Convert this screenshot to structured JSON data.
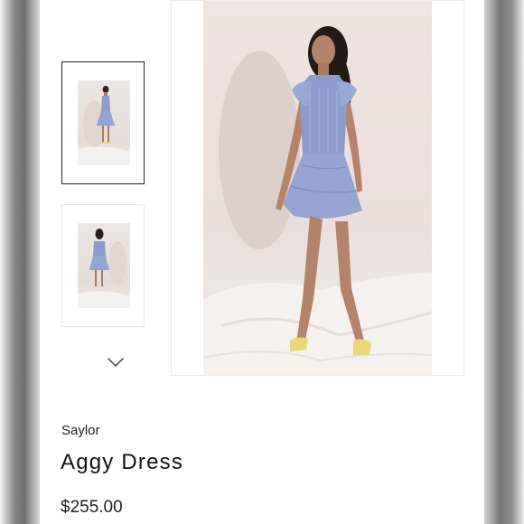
{
  "product": {
    "brand": "Saylor",
    "name": "Aggy Dress",
    "price": "$255.00"
  },
  "gallery": {
    "thumbnails": [
      {
        "view": "front",
        "selected": true
      },
      {
        "view": "back",
        "selected": false
      }
    ],
    "next_icon": "chevron-down-icon"
  },
  "colors": {
    "dress": "#8c9ccc",
    "shoes": "#ecd67a",
    "backdrop": "#ece3de"
  }
}
